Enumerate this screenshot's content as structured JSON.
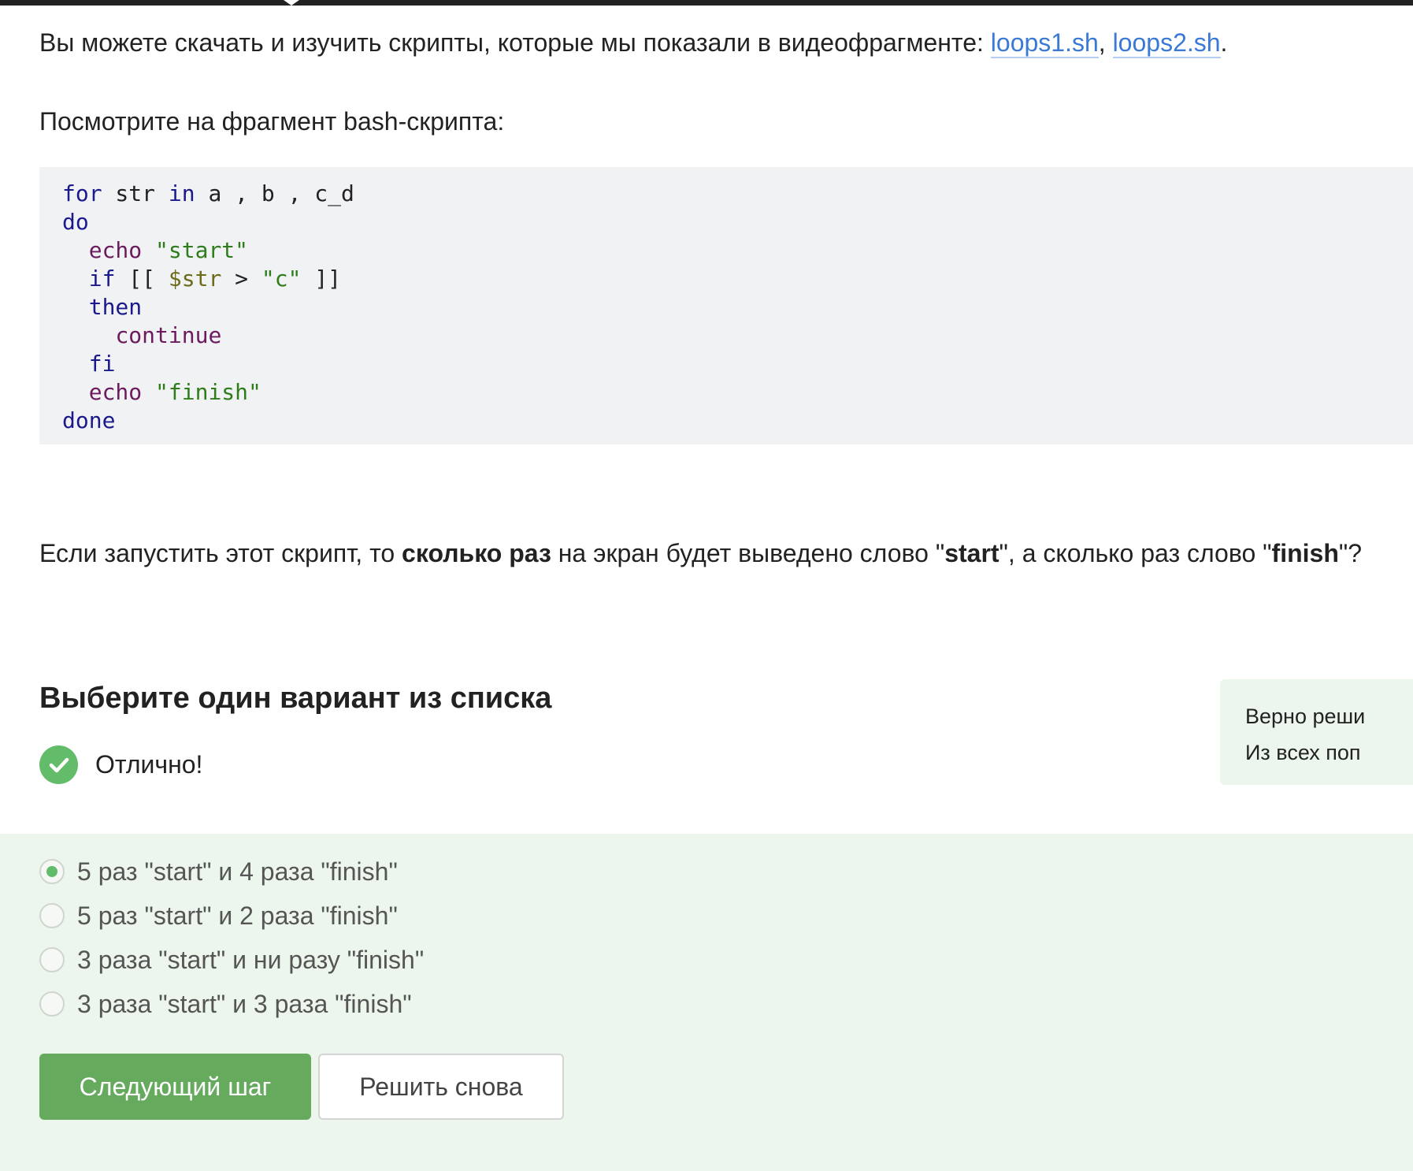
{
  "intro": {
    "text": "Вы можете скачать и изучить скрипты, которые мы показали в видеофрагменте: ",
    "link1": "loops1.sh",
    "separator": ", ",
    "link2": "loops2.sh",
    "end": "."
  },
  "lead": "Посмотрите на фрагмент bash-скрипта:",
  "code": {
    "l1": {
      "kw1": "for",
      "t1": " str ",
      "kw2": "in",
      "t2": " a , b , c_d"
    },
    "l2": {
      "kw": "do"
    },
    "l3": {
      "indent": "  ",
      "cmd": "echo",
      "sp": " ",
      "str": "\"start\""
    },
    "l4": {
      "indent": "  ",
      "kw": "if",
      "t1": " [[ ",
      "var": "$str",
      "t2": " > ",
      "str": "\"c\"",
      "t3": " ]]"
    },
    "l5": {
      "indent": "  ",
      "kw": "then"
    },
    "l6": {
      "indent": "    ",
      "cmd": "continue"
    },
    "l7": {
      "indent": "  ",
      "kw": "fi"
    },
    "l8": {
      "indent": "  ",
      "cmd": "echo",
      "sp": " ",
      "str": "\"finish\""
    },
    "l9": {
      "kw": "done"
    }
  },
  "question": {
    "t1": "Если запустить этот скрипт, то ",
    "b1": "сколько раз",
    "t2": " на экран будет выведено слово \"",
    "b2": "start",
    "t3": "\", а сколько раз слово \"",
    "b3": "finish",
    "t4": "\"?"
  },
  "quiz": {
    "title": "Выберите один вариант из списка",
    "status": "Отлично!",
    "hint_line1": "Верно реши",
    "hint_line2": "Из всех поп",
    "options": [
      {
        "label": "5 раз \"start\" и 4 раза \"finish\"",
        "checked": true
      },
      {
        "label": "5 раз \"start\" и 2 раза \"finish\"",
        "checked": false
      },
      {
        "label": "3 раза \"start\" и ни разу \"finish\"",
        "checked": false
      },
      {
        "label": "3 раза \"start\" и 3 раза \"finish\"",
        "checked": false
      }
    ],
    "next_button": "Следующий шаг",
    "retry_button": "Решить снова"
  },
  "colors": {
    "accent_green": "#66aa5e",
    "check_green": "#62bc6a",
    "link_blue": "#3a79d6",
    "answer_bg": "#ecf6ec"
  }
}
